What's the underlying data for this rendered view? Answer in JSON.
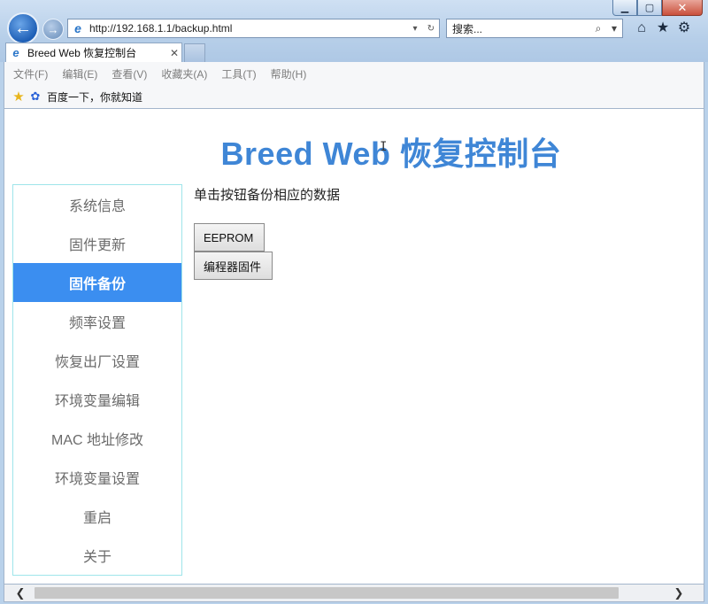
{
  "window": {
    "min_glyph": "▁",
    "max_glyph": "▢",
    "close_glyph": "✕"
  },
  "browser": {
    "back_glyph": "←",
    "forward_glyph": "→",
    "address": {
      "icon_glyph": "e",
      "url": "http://192.168.1.1/backup.html",
      "dropdown_glyph": "▾",
      "refresh_glyph": "↻"
    },
    "search": {
      "placeholder": "搜索...",
      "search_glyph": "⌕",
      "dropdown_glyph": "▾"
    },
    "tools": {
      "home_glyph": "⌂",
      "favorites_glyph": "★",
      "settings_glyph": "⚙"
    },
    "tab": {
      "icon_glyph": "e",
      "title": "Breed Web 恢复控制台",
      "close_glyph": "✕"
    },
    "menu": [
      "文件(F)",
      "编辑(E)",
      "查看(V)",
      "收藏夹(A)",
      "工具(T)",
      "帮助(H)"
    ],
    "favorites_bar": {
      "star_glyph": "★",
      "item_icon_glyph": "✿",
      "item_label": "百度一下，你就知道"
    },
    "scrollbar": {
      "left_glyph": "❮",
      "right_glyph": "❯"
    }
  },
  "page": {
    "title": "Breed Web 恢复控制台",
    "cursor_glyph": "I",
    "sidebar": {
      "items": [
        {
          "label": "系统信息"
        },
        {
          "label": "固件更新"
        },
        {
          "label": "固件备份",
          "active": true
        },
        {
          "label": "频率设置"
        },
        {
          "label": "恢复出厂设置"
        },
        {
          "label": "环境变量编辑"
        },
        {
          "label": "MAC 地址修改"
        },
        {
          "label": "环境变量设置"
        },
        {
          "label": "重启"
        },
        {
          "label": "关于"
        }
      ]
    },
    "content": {
      "instruction": "单击按钮备份相应的数据",
      "eeprom_button": "EEPROM",
      "programmer_button": "编程器固件"
    }
  },
  "colors": {
    "title_blue": "#3f86d6",
    "active_item_bg": "#3b8ef0",
    "sidebar_border": "#9ee5ea"
  }
}
